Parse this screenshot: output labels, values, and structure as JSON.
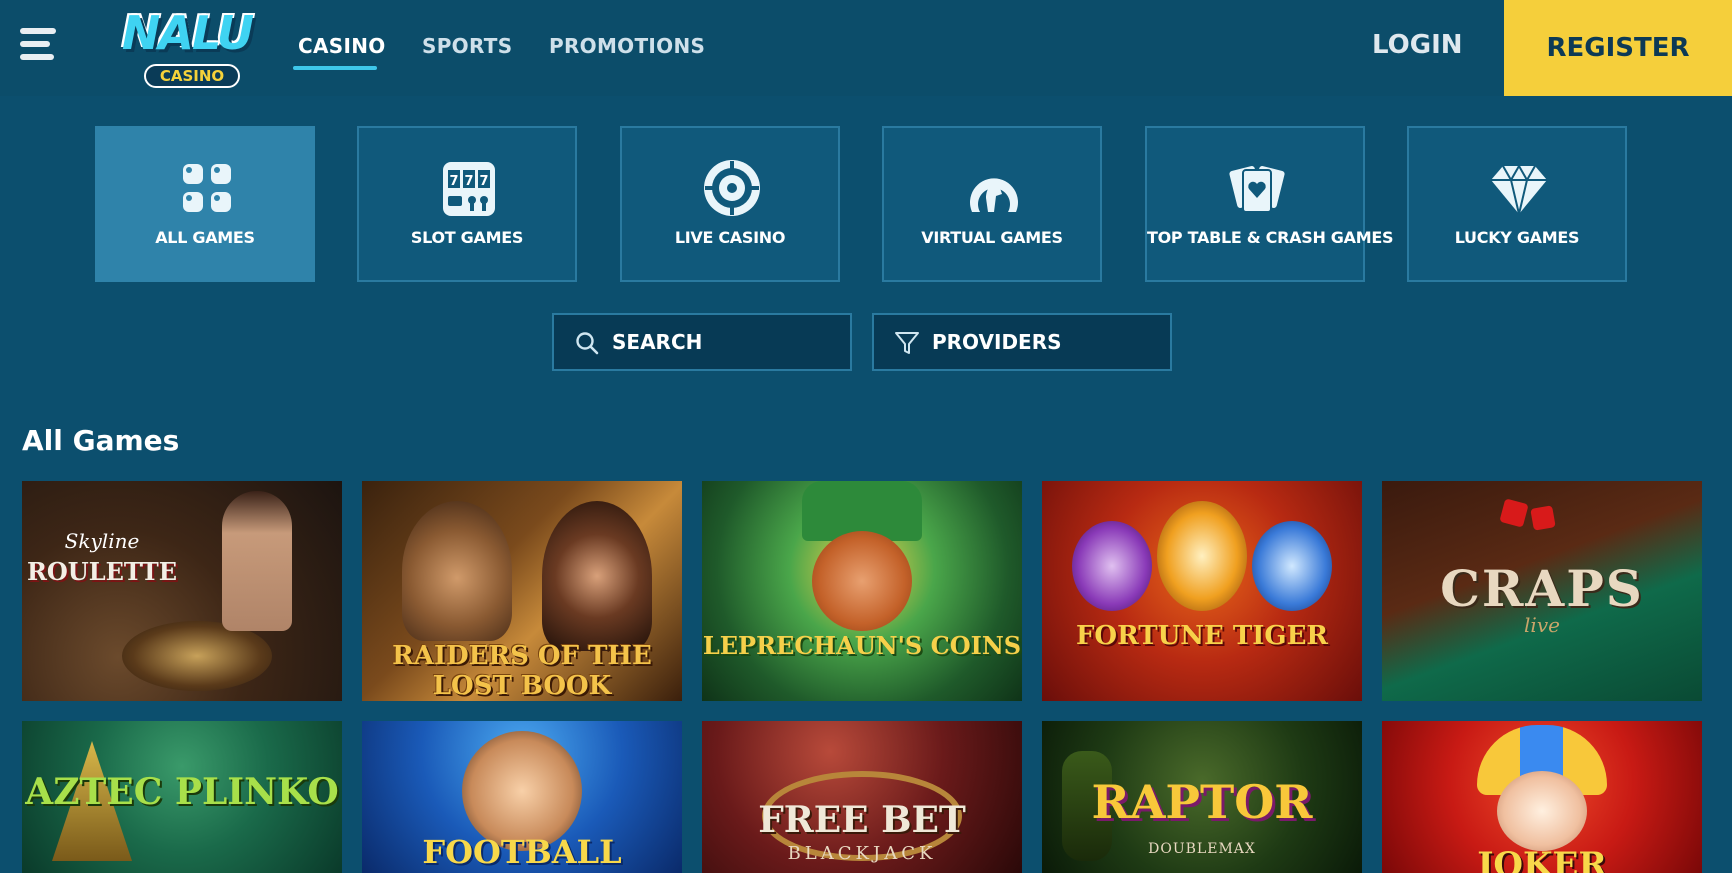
{
  "header": {
    "menu_icon": "hamburger-menu-icon",
    "logo": {
      "word": "NALU",
      "sub": "CASINO"
    },
    "nav": [
      {
        "label": "CASINO",
        "active": true
      },
      {
        "label": "SPORTS",
        "active": false
      },
      {
        "label": "PROMOTIONS",
        "active": false
      }
    ],
    "login_label": "LOGIN",
    "register_label": "REGISTER"
  },
  "categories": [
    {
      "label": "ALL GAMES",
      "icon": "grid-icon",
      "active": true
    },
    {
      "label": "SLOT GAMES",
      "icon": "slot-machine-icon",
      "active": false
    },
    {
      "label": "LIVE CASINO",
      "icon": "roulette-wheel-icon",
      "active": false
    },
    {
      "label": "VIRTUAL GAMES",
      "icon": "horseshoe-horse-icon",
      "active": false
    },
    {
      "label": "TOP TABLE & CRASH GAMES",
      "icon": "playing-cards-icon",
      "active": false
    },
    {
      "label": "LUCKY GAMES",
      "icon": "diamond-icon",
      "active": false
    }
  ],
  "search": {
    "label": "SEARCH",
    "icon": "search-icon"
  },
  "providers": {
    "label": "PROVIDERS",
    "icon": "filter-icon"
  },
  "section_title": "All Games",
  "games": [
    {
      "title": "ROULETTE",
      "subtitle": "Skyline"
    },
    {
      "title": "RAIDERS OF THE LOST BOOK",
      "subtitle": ""
    },
    {
      "title": "LEPRECHAUN'S COINS",
      "subtitle": ""
    },
    {
      "title": "FORTUNE TIGER",
      "subtitle": ""
    },
    {
      "title": "CRAPS",
      "subtitle": "live"
    },
    {
      "title": "AZTEC PLINKO",
      "subtitle": ""
    },
    {
      "title": "FOOTBALL",
      "subtitle": ""
    },
    {
      "title": "FREE BET",
      "subtitle": "BLACKJACK"
    },
    {
      "title": "RAPTOR",
      "subtitle": "DOUBLEMAX"
    },
    {
      "title": "JOKER",
      "subtitle": ""
    }
  ],
  "colors": {
    "background": "#0c4f6e",
    "accent_yellow": "#f5cf3b",
    "accent_cyan": "#3ec7ea",
    "tile_active": "#2f83aa"
  }
}
